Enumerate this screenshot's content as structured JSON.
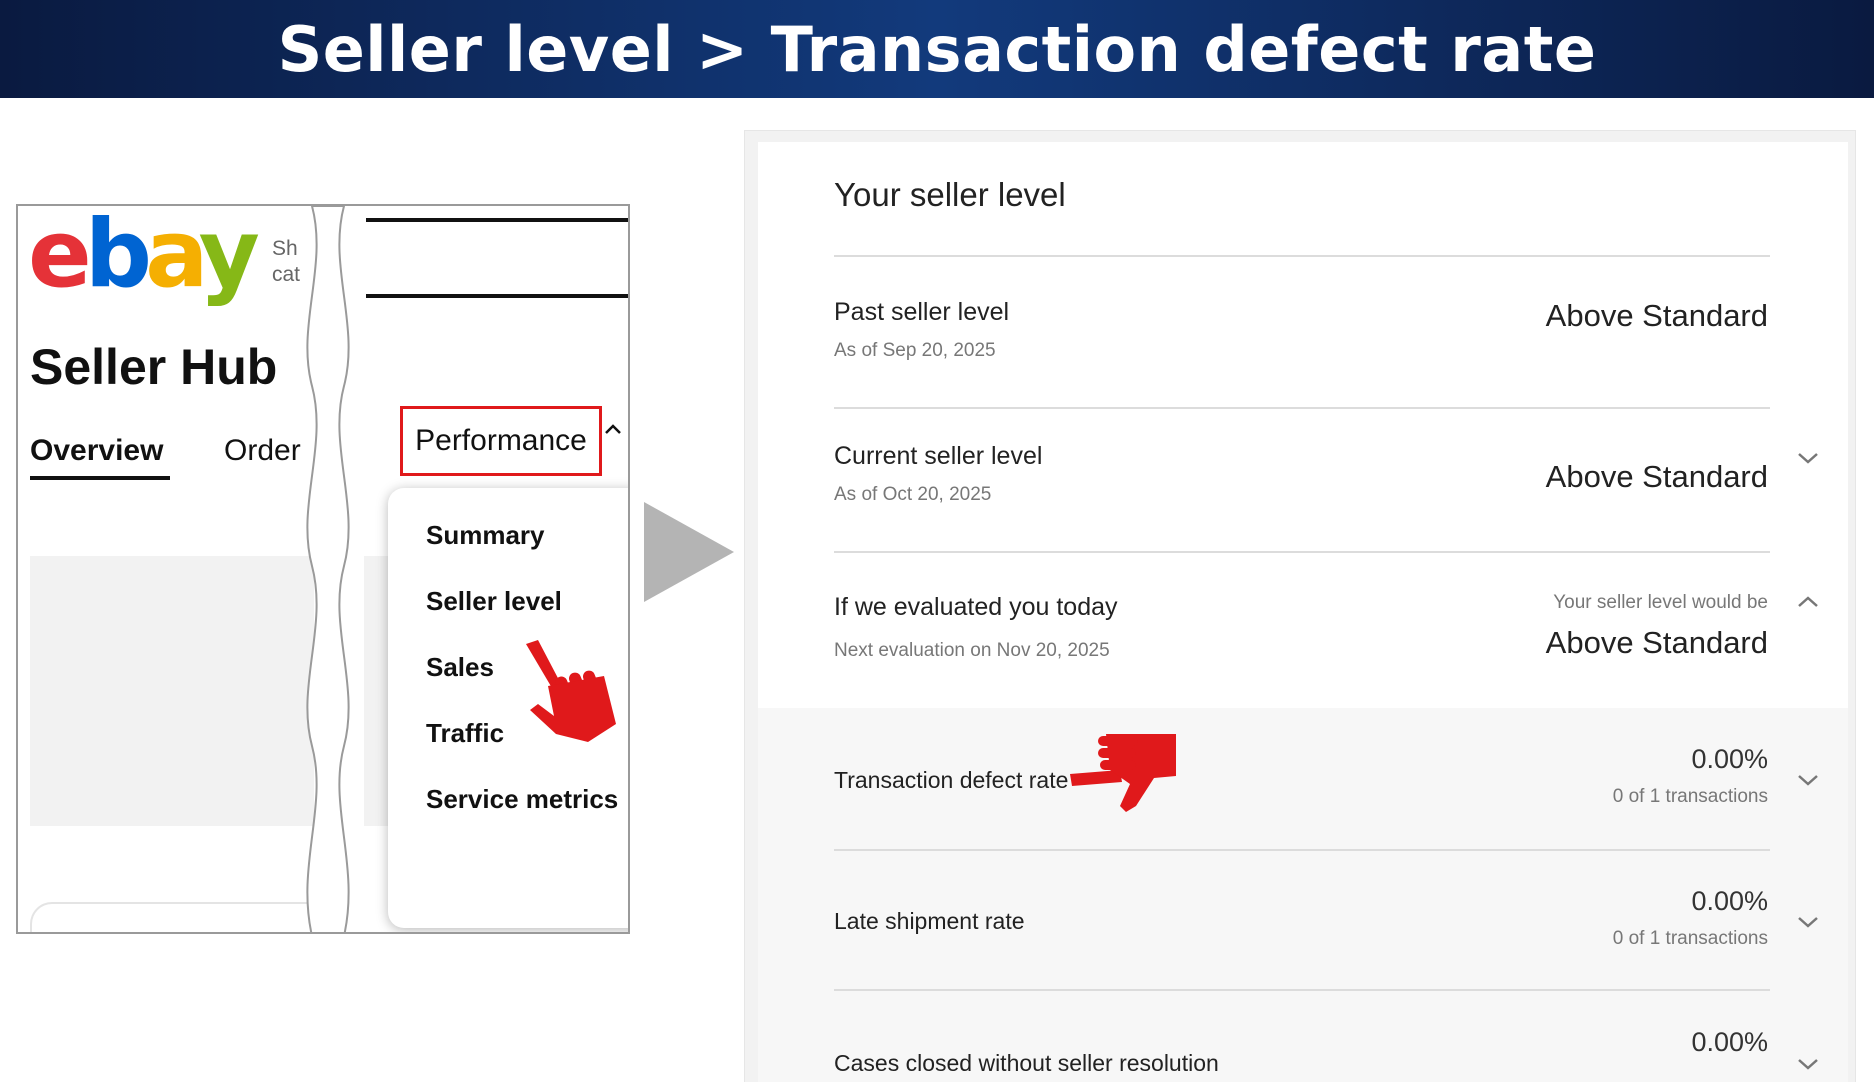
{
  "banner": {
    "title": "Seller level > Transaction defect rate"
  },
  "left_panel": {
    "logo": {
      "e": "e",
      "b": "b",
      "a": "a",
      "y": "y"
    },
    "shop_line1": "Sh",
    "shop_line2": "cat",
    "title": "Seller Hub",
    "tabs": {
      "overview": "Overview",
      "orders": "Order",
      "performance": "Performance"
    },
    "dropdown": [
      "Summary",
      "Seller level",
      "Sales",
      "Traffic",
      "Service metrics"
    ]
  },
  "right_panel": {
    "title": "Your seller level",
    "past": {
      "label": "Past seller level",
      "sub": "As of Sep 20, 2025",
      "value": "Above Standard"
    },
    "current": {
      "label": "Current seller level",
      "sub": "As of Oct 20, 2025",
      "value": "Above Standard"
    },
    "today": {
      "label": "If we evaluated you today",
      "sub": "Next evaluation on Nov 20, 2025",
      "note": "Your seller level would be",
      "value": "Above Standard"
    },
    "metrics": [
      {
        "label": "Transaction defect rate",
        "value": "0.00%",
        "detail": "0 of 1 transactions"
      },
      {
        "label": "Late shipment rate",
        "value": "0.00%",
        "detail": "0 of 1 transactions"
      },
      {
        "label": "Cases closed without seller resolution",
        "value": "0.00%"
      }
    ]
  },
  "colors": {
    "highlight": "#e0191b",
    "banner": "#0d2a5e"
  },
  "icons": [
    "chevron-up-icon",
    "chevron-down-icon",
    "pointing-hand-icon",
    "play-arrow-icon"
  ]
}
